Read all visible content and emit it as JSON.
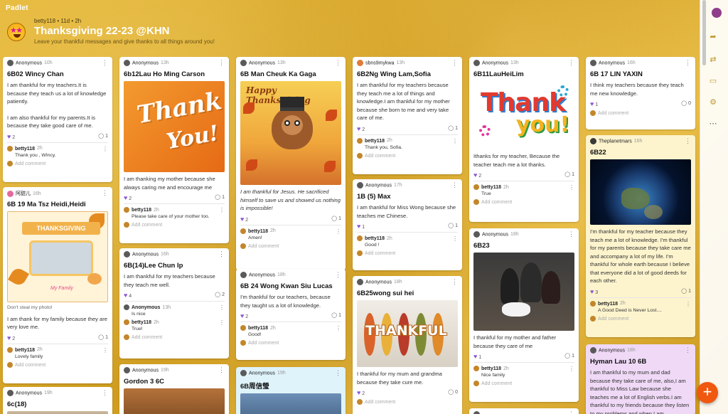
{
  "app": {
    "brand": "Padlet"
  },
  "header": {
    "meta": "betty118 • 11d • 2h",
    "title": "Thanksgiving 22-23 @KHN",
    "subtitle": "Leave your thankful messages and give thanks to all things around you!"
  },
  "common": {
    "add_comment": "Add comment",
    "more": "⋮",
    "heart": "♥",
    "comment_icon": "◯"
  },
  "colors": {
    "accent": "#f0580f",
    "heart": "#8b58d6"
  },
  "cards": {
    "c1": {
      "author": "Anonymous",
      "time": "10h",
      "title": "6B02 Wincy Chan",
      "body1": "I am thankful for my teachers.It is because they teach us a lot of knowledge patiently.",
      "body2": "I am also thankful for my parents.It is because they take good care of me.",
      "likes": "2",
      "comments": "1",
      "c_name": "betty118",
      "c_time": "2h",
      "c_text": "Thank you , WIncy."
    },
    "c2": {
      "author": "阿甜儿",
      "time": "16h",
      "title": "6B 19 Ma Tsz Heidi,Heidi",
      "img_ribbon": "THANKSGIVING",
      "img_sig": "My Family",
      "body": "Don't steal my photo!",
      "body2": "I am thank for my family because they are very love me.",
      "likes": "2",
      "comments": "1",
      "c_name": "betty118",
      "c_time": "2h",
      "c_text": "Lovely family"
    },
    "c3": {
      "author": "Anonymous",
      "time": "19h",
      "title": "6c(18)"
    },
    "c4": {
      "author": "Anonymous",
      "time": "13h",
      "title": "6b12Lau Ho Ming Carson",
      "img_t1": "Thank",
      "img_t2": "You!",
      "body": "I am thanking my mother because she always caring me and encourage me",
      "likes": "2",
      "comments": "1",
      "c_name": "betty118",
      "c_time": "2h",
      "c_text": "Please take care of your mother too."
    },
    "c5": {
      "author": "Anonymous",
      "time": "16h",
      "title": "6B(14)Lee Chun Ip",
      "body": "I am thankful for my teachers because they teach me well.",
      "likes": "4",
      "comments": "2",
      "c1_name": "Anonymous",
      "c1_time": "13h",
      "c1_text": "Is nice",
      "c_name": "betty118",
      "c_time": "2h",
      "c_text": "True!"
    },
    "c6": {
      "author": "Anonymous",
      "time": "19h",
      "title": "Gordon 3 6C"
    },
    "c7": {
      "author": "Anonymous",
      "time": "13h",
      "title": "6B Man Cheuk Ka Gaga",
      "img_banner": "Happy Thanksgiving",
      "body": "I am thankful for Jesus. He sacrificed himself to save us and showed us nothing is impossible!",
      "likes": "2",
      "comments": "1",
      "c_name": "betty118",
      "c_time": "2h",
      "c_text": "Amen!"
    },
    "c8": {
      "author": "Anonymous",
      "time": "18h",
      "title": "6B 24 Wong Kwan Siu Lucas",
      "body": "I'm thankful for our teachers, because they taught us a lot of knowledge.",
      "likes": "2",
      "comments": "1",
      "c_name": "betty118",
      "c_time": "2h",
      "c_text": "Good!"
    },
    "c9": {
      "author": "Anonymous",
      "time": "19h",
      "title": "6B周信瑩"
    },
    "c10": {
      "author": "sbns9mykwa",
      "time": "13h",
      "title": "6B2Ng Wing Lam,Sofia",
      "body": "I am thankful for my teachers because they teach me a lot of things and knowledge.I am thankful for my mother because she born to me and very take care of me.",
      "likes": "2",
      "comments": "1",
      "c_name": "betty118",
      "c_time": "2h",
      "c_text": "Thank you, Sofia."
    },
    "c11": {
      "author": "Anonymous",
      "time": "17h",
      "title": "1B (5) Max",
      "body": "I am thankful for Miss Wong because she teaches me Chinese.",
      "likes": "1",
      "comments": "1",
      "c_name": "betty118",
      "c_time": "2h",
      "c_text": "Good !"
    },
    "c12": {
      "author": "Anonymous",
      "time": "18h",
      "title": "6B25wong sui hei",
      "img_text": "THANKFUL",
      "body": "I thankful for my mum and grandma because they take cure me.",
      "likes": "2",
      "comments": "0"
    },
    "c13": {
      "author": "Anonymous",
      "time": "13h",
      "title": "6B11LauHeiLim",
      "img_t1": "Thank",
      "img_t2": "you!",
      "body": "Ithanks for my teacher,   Because the teacher teach me a lot thanks.",
      "likes": "2",
      "comments": "1",
      "c_name": "betty118",
      "c_time": "2h",
      "c_text": "True"
    },
    "c14": {
      "author": "Anonymous",
      "time": "18h",
      "title": "6B23",
      "body": "I thankful for my mother and father because they care of me",
      "likes": "1",
      "comments": "1",
      "c_name": "betty118",
      "c_time": "2h",
      "c_text": "Nice family"
    },
    "c15": {
      "author": "Anonymous",
      "time": "16h",
      "title": "6B 17 LIN YAXIN",
      "body": "I think my teachers because they teach me new knowledge.",
      "likes": "1",
      "comments": "0"
    },
    "c16": {
      "author": "Theplanetmars",
      "time": "16h",
      "title": "6B22",
      "body": "I'm thankful for my teacher because they teach me a lot of knowledge. I'm thankful for my parents because they take care me and accompany a lot of my life. I'm thankful for whole earth because I believe that everyone did a lot of good deeds for each other.",
      "likes": "3",
      "comments": "1",
      "c_name": "betty118",
      "c_time": "2h",
      "c_text": "A Good Deed is Never Lost...."
    },
    "c17": {
      "author": "Anonymous",
      "time": "18h",
      "title": "Hyman Lau 10 6B",
      "body": "I am thankful to my mum and dad because they take care of me, also,I am thankful to Miss Law because she teaches me a lot of English verbs.I am thankful to my friends because they listen to my problems and when I am"
    }
  },
  "fab": {
    "label": "+"
  }
}
